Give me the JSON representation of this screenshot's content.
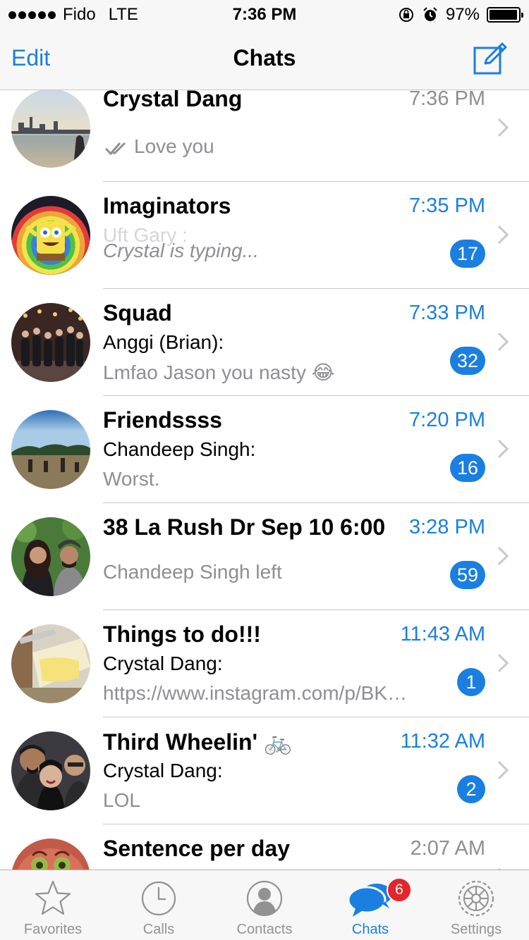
{
  "status_bar": {
    "carrier": "Fido",
    "network": "LTE",
    "time": "7:36 PM",
    "battery": "97%",
    "battery_level": 0.97,
    "icons": [
      "signal-dots-icon",
      "rotation-lock-icon",
      "alarm-icon",
      "battery-icon"
    ]
  },
  "nav": {
    "edit_label": "Edit",
    "title": "Chats",
    "compose_icon": "compose-icon"
  },
  "chats": [
    {
      "name": "Crystal Dang",
      "time": "7:36 PM",
      "time_unread": false,
      "line1": "",
      "line2": "Love you",
      "read_receipt": true,
      "badge": ""
    },
    {
      "name": "Imaginators",
      "time": "7:35 PM",
      "time_unread": true,
      "ghost": "Uft Gary :",
      "line1": "",
      "line2": "Crystal is typing...",
      "typing": true,
      "badge": "17"
    },
    {
      "name": "Squad",
      "time": "7:33 PM",
      "time_unread": true,
      "line1": "Anggi (Brian):",
      "line2": "Lmfao Jason you nasty 😂",
      "badge": "32"
    },
    {
      "name": "Friendssss",
      "time": "7:20 PM",
      "time_unread": true,
      "line1": "Chandeep Singh:",
      "line2": "Worst.",
      "badge": "16"
    },
    {
      "name": "38 La Rush Dr Sep 10 6:00",
      "time": "3:28 PM",
      "time_unread": true,
      "line1": "",
      "line2": "Chandeep Singh left",
      "badge": "59"
    },
    {
      "name": "Things to do!!!",
      "time": "11:43 AM",
      "time_unread": true,
      "line1": "Crystal Dang:",
      "line2": "https://www.instagram.com/p/BK…",
      "badge": "1"
    },
    {
      "name": "Third Wheelin' 🚲",
      "time": "11:32 AM",
      "time_unread": true,
      "line1": "Crystal Dang:",
      "line2": "LOL",
      "badge": "2"
    },
    {
      "name": "Sentence per day",
      "time": "2:07 AM",
      "time_unread": false,
      "line1": "",
      "line2": "",
      "badge": ""
    }
  ],
  "tabs": [
    {
      "label": "Favorites",
      "icon": "star-icon",
      "active": false
    },
    {
      "label": "Calls",
      "icon": "clock-icon",
      "active": false
    },
    {
      "label": "Contacts",
      "icon": "contact-icon",
      "active": false
    },
    {
      "label": "Chats",
      "icon": "chat-bubbles-icon",
      "active": true,
      "badge": "6"
    },
    {
      "label": "Settings",
      "icon": "gear-icon",
      "active": false
    }
  ],
  "colors": {
    "accent": "#1a7fe0",
    "badge_red": "#e3262b",
    "secondary_text": "#8e8e93"
  }
}
